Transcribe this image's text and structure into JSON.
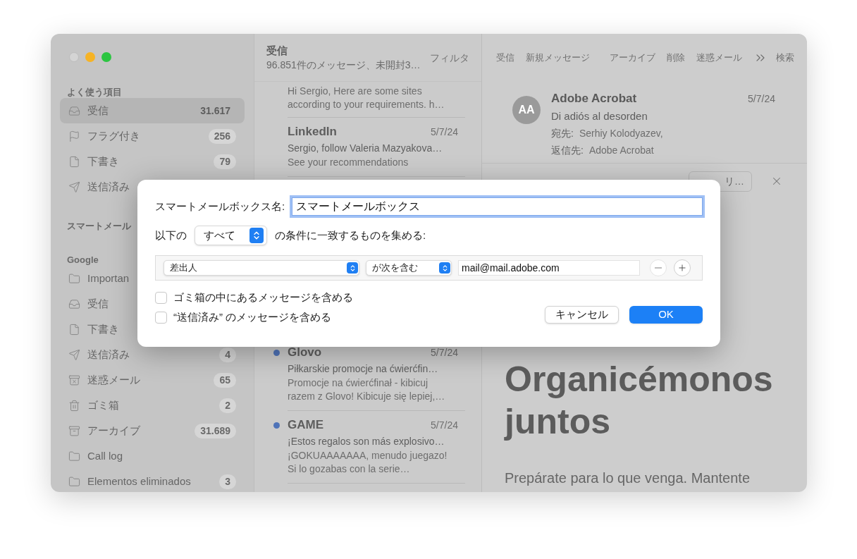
{
  "sidebar": {
    "sections": [
      {
        "title": "よく使う項目",
        "items": [
          {
            "label": "受信",
            "kind": "inbox",
            "count": "31.617",
            "selected": true
          },
          {
            "label": "フラグ付き",
            "kind": "flag",
            "count": "256",
            "selected": false
          },
          {
            "label": "下書き",
            "kind": "draft",
            "count": "79",
            "selected": false
          },
          {
            "label": "送信済み",
            "kind": "sent",
            "selected": false
          }
        ]
      },
      {
        "title": "スマートメール"
      },
      {
        "title": "Google",
        "items": [
          {
            "label": "Importan",
            "kind": "folder",
            "selected": false
          },
          {
            "label": "受信",
            "kind": "inbox",
            "selected": false
          },
          {
            "label": "下書き",
            "kind": "draft",
            "selected": false
          },
          {
            "label": "送信済み",
            "kind": "sent",
            "count": "4",
            "selected": false
          },
          {
            "label": "迷惑メール",
            "kind": "junk",
            "count": "65",
            "selected": false
          },
          {
            "label": "ゴミ箱",
            "kind": "trash",
            "count": "2",
            "selected": false
          },
          {
            "label": "アーカイブ",
            "kind": "archive",
            "count": "31.689",
            "selected": false
          },
          {
            "label": "Call log",
            "kind": "folder",
            "selected": false
          },
          {
            "label": "Elementos eliminados",
            "kind": "folder",
            "count": "3",
            "selected": false
          }
        ]
      }
    ]
  },
  "message_list": {
    "title": "受信",
    "subtitle": "96.851件のメッセージ、未開封3…",
    "filter": "フィルタ",
    "messages": [
      {
        "preview": "Hi Sergio, Here are some sites according to your requirements. h…",
        "unread": false
      },
      {
        "sender": "LinkedIn",
        "date": "5/7/24",
        "subject": "Sergio, follow Valeria Mazyakova…",
        "preview": "See your recommendations",
        "unread": false
      },
      {
        "sender": "Glovo",
        "date": "5/7/24",
        "subject": "Piłkarskie promocje na ćwierćfin…",
        "preview": "Promocje na ćwierćfinał - kibicuj razem z Glovo! Kibicuje się lepiej,…",
        "unread": true
      },
      {
        "sender": "GAME",
        "date": "5/7/24",
        "subject": "¡Estos regalos son más explosivo…",
        "preview": "¡GOKUAAAAAAA, menudo juegazo! Si lo gozabas con la serie…",
        "unread": true
      }
    ]
  },
  "toolbar": {
    "items": [
      "受信",
      "新規メッセージ",
      "アーカイブ",
      "削除",
      "迷惑メール",
      "検索"
    ]
  },
  "message": {
    "avatar": "AA",
    "sender": "Adobe Acrobat",
    "date": "5/7/24",
    "subject": "Di adiós al desorden",
    "to_label": "宛先:",
    "to": "Serhiy Kolodyazev,",
    "reply_to_label": "返信先:",
    "reply_to": "Adobe Acrobat",
    "banner_button": "リ…",
    "body_heading": "Organicémonos juntos",
    "body_text": "Prepárate para lo que venga. Mantente"
  },
  "dialog": {
    "name_label": "スマートメールボックス名:",
    "name_value": "スマートメールボックス",
    "match_prefix": "以下の",
    "match_select": "すべて",
    "match_suffix": "の条件に一致するものを集める:",
    "rules": [
      {
        "field": "差出人",
        "operator": "が次を含む",
        "value": "mail@mail.adobe.com",
        "remove_disabled": true
      }
    ],
    "options": [
      {
        "label": "ゴミ箱の中にあるメッセージを含める",
        "checked": false
      },
      {
        "label": "“送信済み” のメッセージを含める",
        "checked": false
      }
    ],
    "cancel": "キャンセル",
    "ok": "OK"
  }
}
